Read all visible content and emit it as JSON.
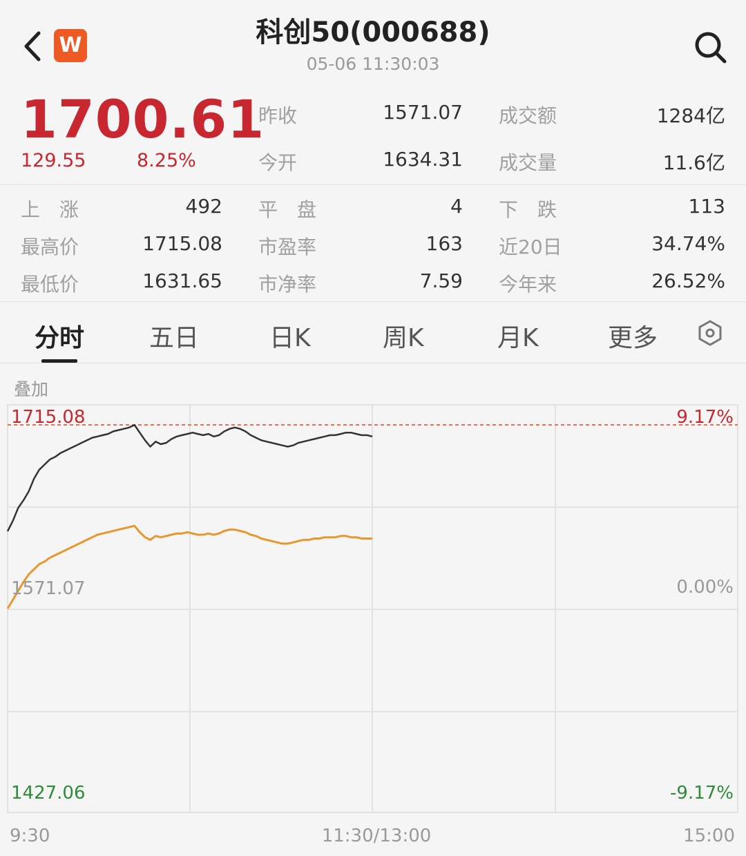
{
  "header": {
    "title": "科创50(000688)",
    "datetime": "05-06 11:30:03",
    "back_icon": "chevron-left-icon",
    "logo_text": "W",
    "search_icon": "search-icon"
  },
  "quote": {
    "price": "1700.61",
    "change": "129.55",
    "change_pct": "8.25%",
    "up_color": "#c8272f",
    "down_color": "#2e8b3a"
  },
  "stats": {
    "prev_close_label": "昨收",
    "prev_close": "1571.07",
    "open_label": "今开",
    "open": "1634.31",
    "turnover_label": "成交额",
    "turnover": "1284亿",
    "volume_label": "成交量",
    "volume": "11.6亿",
    "up_label": "上　涨",
    "up": "492",
    "flat_label": "平　盘",
    "flat": "4",
    "down_label": "下　跌",
    "down": "113",
    "high_label": "最高价",
    "high": "1715.08",
    "pe_label": "市盈率",
    "pe": "163",
    "d20_label": "近20日",
    "d20": "34.74%",
    "low_label": "最低价",
    "low": "1631.65",
    "pb_label": "市净率",
    "pb": "7.59",
    "ytd_label": "今年来",
    "ytd": "26.52%"
  },
  "tabs": [
    {
      "label": "分时"
    },
    {
      "label": "五日"
    },
    {
      "label": "日K"
    },
    {
      "label": "周K"
    },
    {
      "label": "月K"
    },
    {
      "label": "更多"
    }
  ],
  "active_tab": "分时",
  "chart": {
    "overlay_label": "叠加",
    "top_value": "1715.08",
    "top_pct": "9.17%",
    "mid_value": "1571.07",
    "mid_pct": "0.00%",
    "bottom_value": "1427.06",
    "bottom_pct": "-9.17%",
    "time_start": "9:30",
    "time_mid": "11:30/13:00",
    "time_end": "15:00"
  },
  "chart_data": {
    "type": "line",
    "x_labels": [
      "9:30",
      "11:30/13:00",
      "15:00"
    ],
    "ylim": [
      1427.06,
      1715.08
    ],
    "baseline": 1571.07,
    "grid": true,
    "series": [
      {
        "color": "#333333",
        "values": [
          1631.7,
          1640,
          1650,
          1656,
          1663,
          1673,
          1680,
          1684,
          1688,
          1690,
          1693,
          1695,
          1697,
          1699,
          1701,
          1703,
          1705,
          1706,
          1707,
          1708,
          1710,
          1711,
          1712,
          1713,
          1715.08,
          1709,
          1703,
          1698,
          1702,
          1700,
          1701,
          1704,
          1706,
          1707,
          1708,
          1709,
          1708,
          1707,
          1708,
          1706,
          1707,
          1710,
          1712,
          1713,
          1712,
          1710,
          1707,
          1705,
          1703,
          1702,
          1701,
          1700,
          1699,
          1698,
          1699,
          1701,
          1702,
          1703,
          1704,
          1705,
          1706,
          1707,
          1707,
          1708,
          1709,
          1709,
          1708,
          1707,
          1707,
          1706
        ]
      },
      {
        "color": "#e8962e",
        "values": [
          1571.1,
          1578,
          1585,
          1592,
          1598,
          1602,
          1606,
          1608,
          1611,
          1613,
          1615,
          1617,
          1619,
          1621,
          1623,
          1625,
          1627,
          1629,
          1630,
          1631,
          1632,
          1633,
          1634,
          1635,
          1636,
          1631,
          1627,
          1625,
          1628,
          1627,
          1628,
          1629,
          1630,
          1630,
          1631,
          1630,
          1629,
          1629,
          1630,
          1629,
          1630,
          1632,
          1633,
          1633,
          1632,
          1631,
          1629,
          1628,
          1626,
          1625,
          1624,
          1623,
          1622,
          1622,
          1623,
          1624,
          1625,
          1625,
          1626,
          1626,
          1627,
          1627,
          1627,
          1628,
          1628,
          1627,
          1627,
          1626,
          1626,
          1626
        ]
      }
    ]
  }
}
